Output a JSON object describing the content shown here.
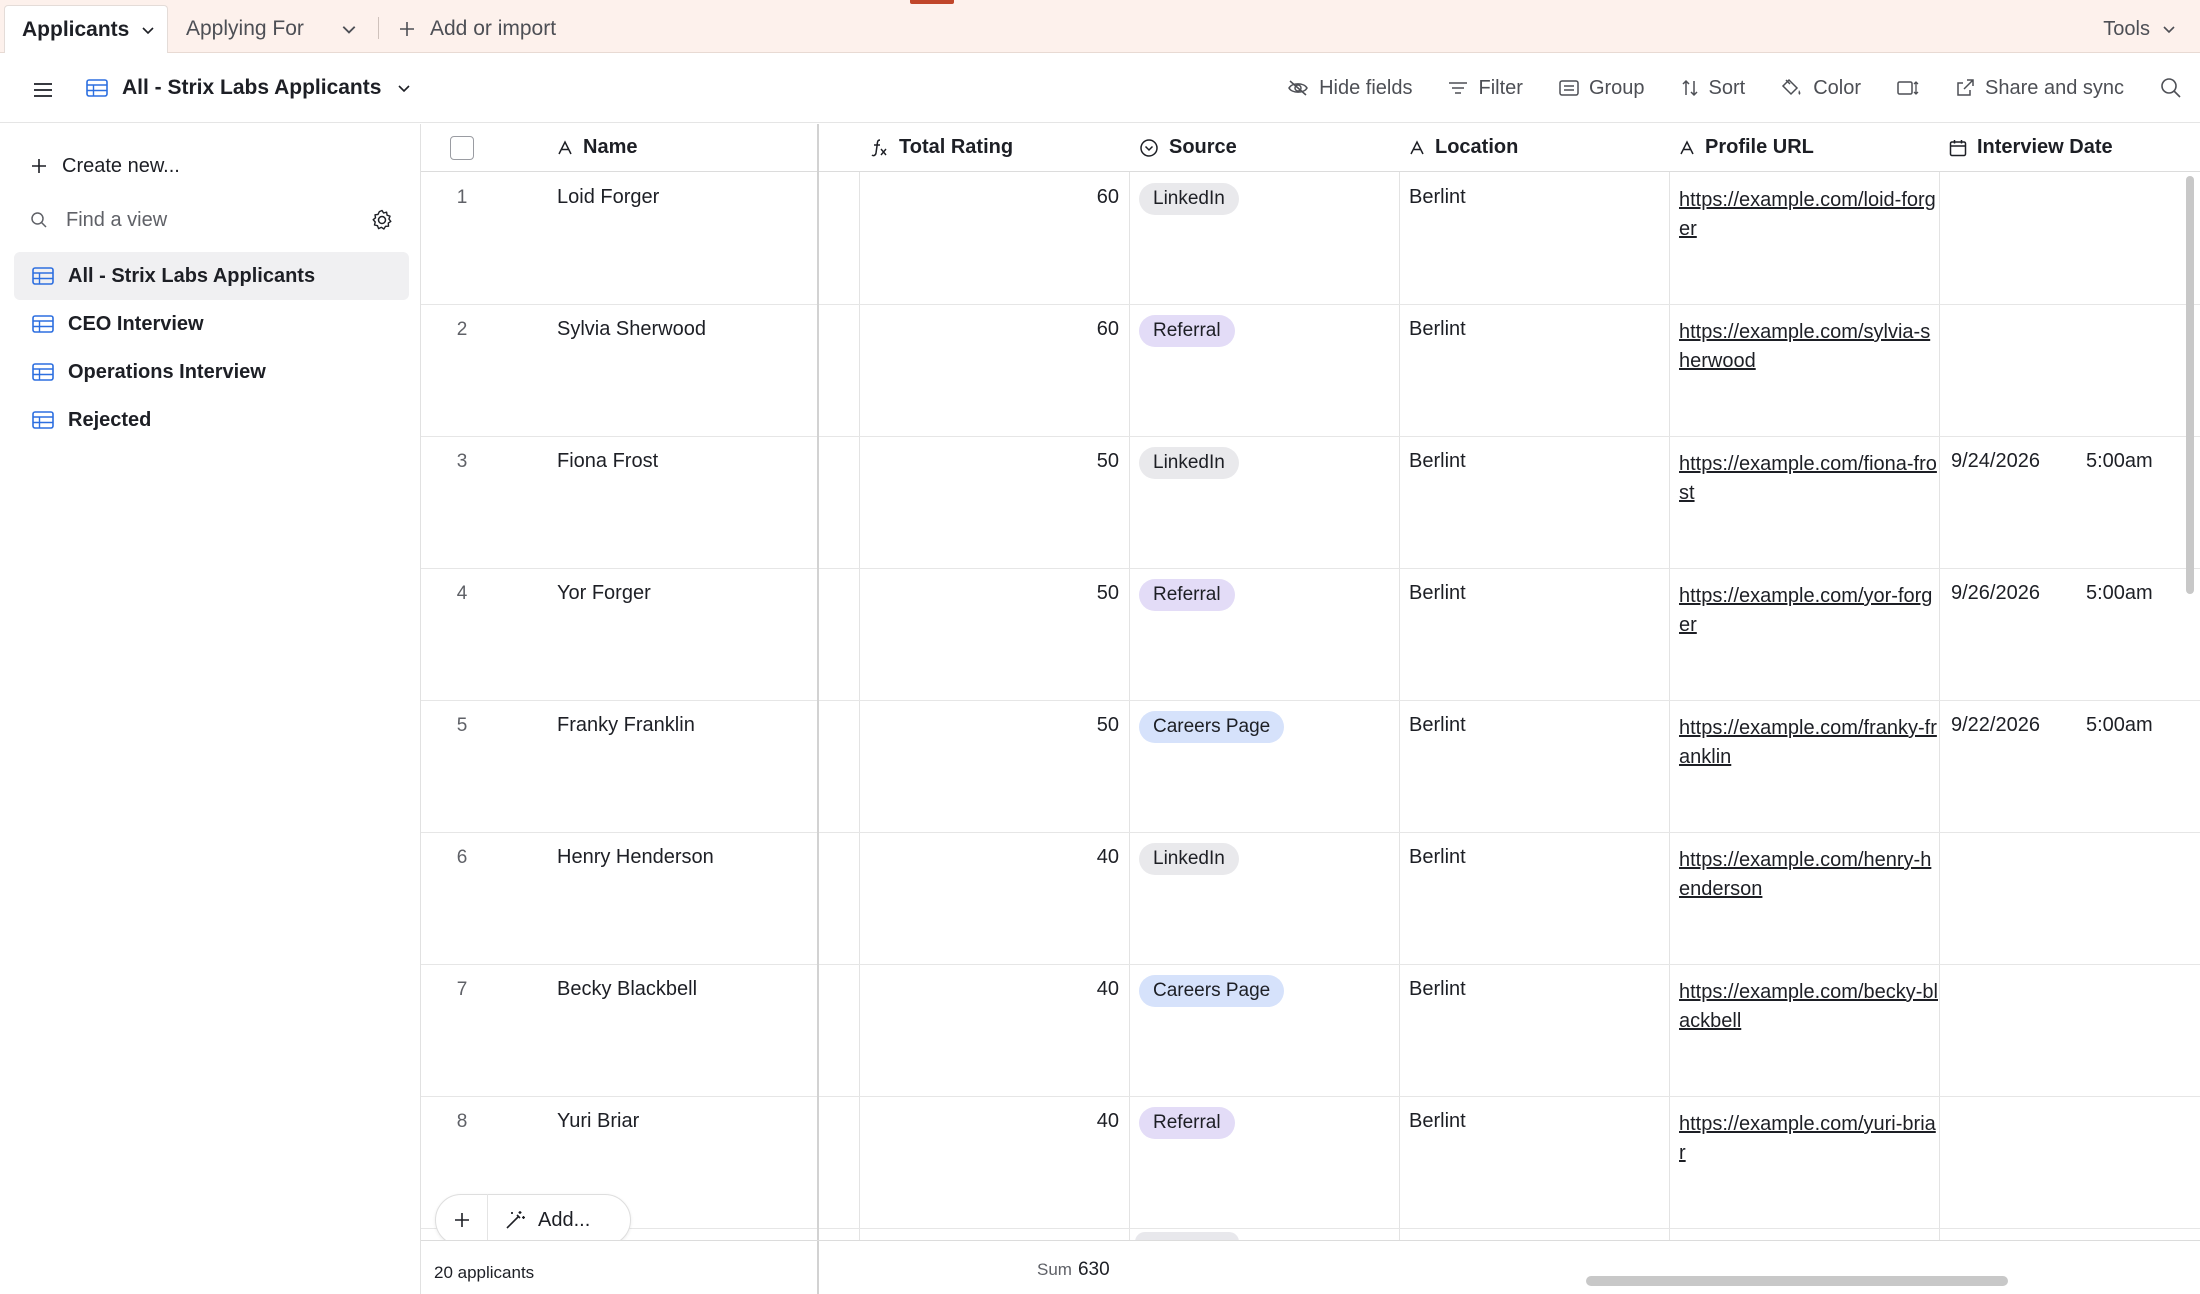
{
  "tabs": {
    "active": "Applicants",
    "inactive": "Applying For",
    "add_label": "Add or import",
    "tools_label": "Tools"
  },
  "viewbar": {
    "current_view": "All - Strix Labs Applicants",
    "hide_fields": "Hide fields",
    "filter": "Filter",
    "group": "Group",
    "sort": "Sort",
    "color": "Color",
    "share": "Share and sync"
  },
  "sidebar": {
    "create_new": "Create new...",
    "find_placeholder": "Find a view",
    "views": [
      {
        "label": "All - Strix Labs Applicants",
        "active": true
      },
      {
        "label": "CEO Interview",
        "active": false
      },
      {
        "label": "Operations Interview",
        "active": false
      },
      {
        "label": "Rejected",
        "active": false
      }
    ]
  },
  "grid": {
    "columns": {
      "name": "Name",
      "total_rating": "Total Rating",
      "source": "Source",
      "location": "Location",
      "profile_url": "Profile URL",
      "interview_date": "Interview Date"
    },
    "rows": [
      {
        "num": "1",
        "name": "Loid Forger",
        "rating": "60",
        "source": "LinkedIn",
        "location": "Berlint",
        "url": "https://example.com/loid-forger",
        "date": "",
        "time": ""
      },
      {
        "num": "2",
        "name": "Sylvia Sherwood",
        "rating": "60",
        "source": "Referral",
        "location": "Berlint",
        "url": "https://example.com/sylvia-sherwood",
        "date": "",
        "time": ""
      },
      {
        "num": "3",
        "name": "Fiona Frost",
        "rating": "50",
        "source": "LinkedIn",
        "location": "Berlint",
        "url": "https://example.com/fiona-frost",
        "date": "9/24/2026",
        "time": "5:00am"
      },
      {
        "num": "4",
        "name": "Yor Forger",
        "rating": "50",
        "source": "Referral",
        "location": "Berlint",
        "url": "https://example.com/yor-forger",
        "date": "9/26/2026",
        "time": "5:00am"
      },
      {
        "num": "5",
        "name": "Franky Franklin",
        "rating": "50",
        "source": "Careers Page",
        "location": "Berlint",
        "url": "https://example.com/franky-franklin",
        "date": "9/22/2026",
        "time": "5:00am"
      },
      {
        "num": "6",
        "name": "Henry Henderson",
        "rating": "40",
        "source": "LinkedIn",
        "location": "Berlint",
        "url": "https://example.com/henry-henderson",
        "date": "",
        "time": ""
      },
      {
        "num": "7",
        "name": "Becky Blackbell",
        "rating": "40",
        "source": "Careers Page",
        "location": "Berlint",
        "url": "https://example.com/becky-blackbell",
        "date": "",
        "time": ""
      },
      {
        "num": "8",
        "name": "Yuri Briar",
        "rating": "40",
        "source": "Referral",
        "location": "Berlint",
        "url": "https://example.com/yuri-briar",
        "date": "",
        "time": ""
      }
    ],
    "source_colors": {
      "LinkedIn": "#e9e9ec",
      "Referral": "#e3dcf7",
      "Careers Page": "#d6e2fb"
    },
    "add_label": "Add...",
    "footer": {
      "count": "20 applicants",
      "sum_label": "Sum",
      "sum_value": "630"
    }
  }
}
